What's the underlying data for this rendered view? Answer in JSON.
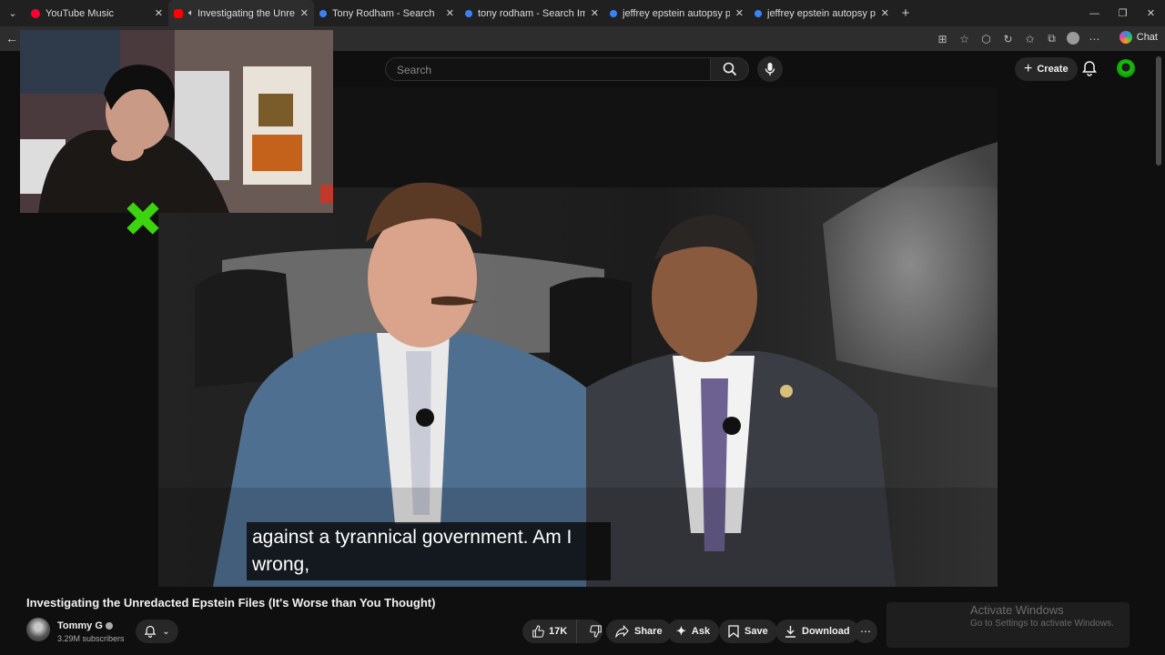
{
  "browser": {
    "tabs": [
      {
        "label": "YouTube Music",
        "favicon_color": "#ff0033",
        "active": false
      },
      {
        "label": "Investigating the Unredacted",
        "favicon_color": "#ff0000",
        "active": true,
        "audio": true
      },
      {
        "label": "Tony Rodham - Search",
        "favicon_color": "#3b82f6",
        "active": false
      },
      {
        "label": "tony rodham - Search Images",
        "favicon_color": "#3b82f6",
        "active": false
      },
      {
        "label": "jeffrey epstein autopsy pdf - Searc",
        "favicon_color": "#3b82f6",
        "active": false
      },
      {
        "label": "jeffrey epstein autopsy pdf - Searc",
        "favicon_color": "#3b82f6",
        "active": false
      }
    ],
    "chat_label": "Chat"
  },
  "youtube": {
    "search_placeholder": "Search",
    "create_label": "Create"
  },
  "video": {
    "caption_line1": "against a tyrannical government. Am I",
    "caption_line2": "wrong,",
    "title": "Investigating the Unredacted Epstein Files (It's Worse than You Thought)",
    "channel_name": "Tommy G",
    "subscribers": "3.29M subscribers",
    "likes": "17K",
    "share_label": "Share",
    "ask_label": "Ask",
    "save_label": "Save",
    "download_label": "Download"
  },
  "overlay": {
    "activate_title": "Activate Windows",
    "activate_sub": "Go to Settings to activate Windows."
  }
}
